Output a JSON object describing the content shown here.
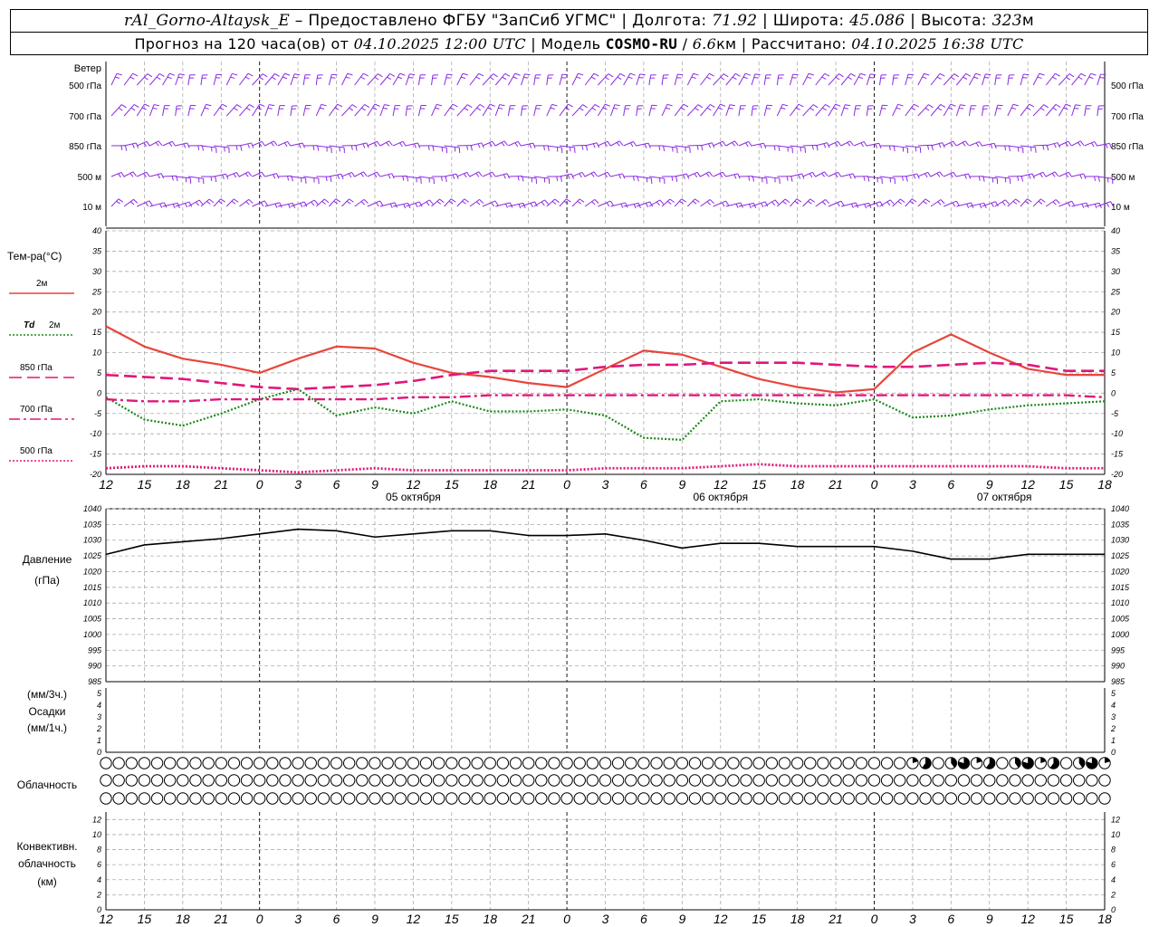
{
  "header": {
    "station": "rAl_Gorno-Altaysk_E",
    "dash": "–",
    "provided_label": "Предоставлено ФГБУ",
    "provider": "\"ЗапСиб УГМС\"",
    "lon_label": "Долгота:",
    "lon_value": "71.92",
    "lat_label": "Широта:",
    "lat_value": "45.086",
    "alt_label": "Высота:",
    "alt_value": "323",
    "alt_unit": "м",
    "forecast_label": "Прогноз на 120 часа(ов)  от",
    "forecast_start": "04.10.2025 12:00 UTC",
    "model_label": "Модель",
    "model_name": "COSMO-RU",
    "model_res": "6.6",
    "model_res_unit": "км",
    "computed_label": "Рассчитано:",
    "computed_time": "04.10.2025 16:38 UTC",
    "sep": "|"
  },
  "chart_data": [
    {
      "type": "wind-barbs",
      "title": "Ветер",
      "levels": [
        "500 гПа",
        "700 гПа",
        "850 гПа",
        "500 м",
        "10 м"
      ],
      "colors": {
        "barb": "#8a2be2"
      }
    },
    {
      "type": "line",
      "title": "Тем-ра(°C)",
      "ylim": [
        -20,
        40
      ],
      "yticks": [
        -20,
        -15,
        -10,
        -5,
        0,
        5,
        10,
        15,
        20,
        25,
        30,
        35,
        40
      ],
      "x_hours": [
        0,
        3,
        6,
        9,
        12,
        15,
        18,
        21,
        24,
        27,
        30,
        33,
        36,
        39,
        42,
        45,
        48,
        51,
        54,
        57,
        60,
        63,
        66,
        69,
        72,
        75,
        78
      ],
      "series": [
        {
          "name": "2м",
          "color": "#e8453c",
          "dash": "solid",
          "values": [
            16.5,
            11.5,
            8.5,
            7,
            5,
            8.5,
            11.5,
            11,
            7.5,
            5,
            4,
            2.5,
            1.5,
            6,
            10.5,
            9.5,
            6.5,
            3.5,
            1.5,
            0.2,
            1,
            10,
            14.5,
            10,
            6,
            4.5,
            4.5
          ]
        },
        {
          "name": "Td 2м",
          "color": "#1a8a1a",
          "dash": "dotted",
          "values": [
            -1,
            -6.5,
            -8,
            -5,
            -1.5,
            1,
            -5.5,
            -3.5,
            -5,
            -2,
            -4.5,
            -4.5,
            -4,
            -5.5,
            -11,
            -11.5,
            -2,
            -1.5,
            -2.5,
            -3,
            -1.5,
            -6,
            -5.5,
            -4,
            -3,
            -2.5,
            -2
          ]
        },
        {
          "name": "850 гПа",
          "color": "#e0177a",
          "dash": "longdash",
          "values": [
            4.5,
            4,
            3.5,
            2.5,
            1.5,
            1,
            1.5,
            2,
            3,
            4.5,
            5.5,
            5.5,
            5.5,
            6.5,
            7,
            7,
            7.5,
            7.5,
            7.5,
            7,
            6.5,
            6.5,
            7,
            7.5,
            7,
            5.5,
            5.5
          ]
        },
        {
          "name": "700 гПа",
          "color": "#e0177a",
          "dash": "dashdot",
          "values": [
            -1.5,
            -2,
            -2,
            -1.5,
            -1.5,
            -1.5,
            -1.5,
            -1.5,
            -1,
            -1,
            -0.5,
            -0.5,
            -0.5,
            -0.5,
            -0.5,
            -0.5,
            -0.5,
            -0.5,
            -0.5,
            -0.5,
            -0.5,
            -0.5,
            -0.5,
            -0.5,
            -0.5,
            -0.5,
            -1
          ]
        },
        {
          "name": "500 гПа",
          "color": "#e0177a",
          "dash": "dotted",
          "values": [
            -18.5,
            -18,
            -18,
            -18.5,
            -19,
            -19.5,
            -19,
            -18.5,
            -19,
            -19,
            -19,
            -19,
            -19,
            -18.5,
            -18.5,
            -18.5,
            -18,
            -17.5,
            -18,
            -18,
            -18,
            -18,
            -18,
            -18,
            -18,
            -18.5,
            -18.5
          ]
        }
      ]
    },
    {
      "type": "line",
      "title": "Давление",
      "unit": "(гПа)",
      "ylim": [
        985,
        1040
      ],
      "yticks": [
        985,
        990,
        995,
        1000,
        1005,
        1010,
        1015,
        1020,
        1025,
        1030,
        1035,
        1040
      ],
      "x_hours": [
        0,
        3,
        6,
        9,
        12,
        15,
        18,
        21,
        24,
        27,
        30,
        33,
        36,
        39,
        42,
        45,
        48,
        51,
        54,
        57,
        60,
        63,
        66,
        69,
        72,
        75,
        78
      ],
      "series": [
        {
          "name": "",
          "color": "#000000",
          "values": [
            1025.5,
            1028.5,
            1029.5,
            1030.5,
            1032,
            1033.5,
            1033,
            1031,
            1032,
            1033,
            1033,
            1031.5,
            1031.5,
            1032,
            1030,
            1027.5,
            1029,
            1029,
            1028,
            1028,
            1028,
            1026.5,
            1024,
            1024,
            1025.5,
            1025.5,
            1025.5
          ]
        }
      ]
    },
    {
      "type": "bar",
      "title": "Осадки",
      "unit_top": "(мм/3ч.)",
      "unit_bottom": "(мм/1ч.)",
      "ylim": [
        0,
        5
      ],
      "yticks": [
        0,
        1,
        2,
        3,
        4,
        5
      ],
      "values": []
    },
    {
      "type": "symbols",
      "title": "Облачность",
      "rows": 3
    },
    {
      "type": "bar",
      "title": "Конвективн. облачность",
      "unit": "(км)",
      "ylim": [
        0,
        13
      ],
      "yticks": [
        0,
        2,
        4,
        6,
        8,
        10,
        12
      ],
      "values": []
    }
  ],
  "time_axis": {
    "hour_labels": [
      "12",
      "15",
      "18",
      "21",
      "0",
      "3",
      "6",
      "9",
      "12",
      "15",
      "18",
      "21",
      "0",
      "3",
      "6",
      "9",
      "12",
      "15",
      "18",
      "21",
      "0",
      "3",
      "6",
      "9",
      "12",
      "15",
      "18"
    ],
    "date_labels": [
      "05 октября",
      "06 октября",
      "07 октября"
    ]
  }
}
